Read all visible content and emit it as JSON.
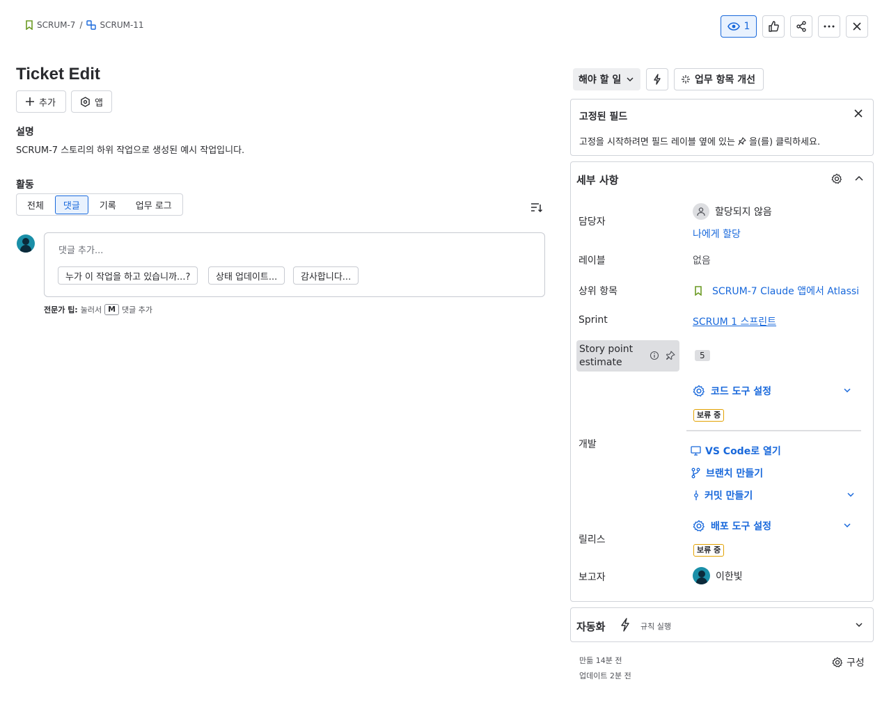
{
  "breadcrumb": {
    "parent": "SCRUM-7",
    "separator": "/",
    "current": "SCRUM-11"
  },
  "toolbar": {
    "watch_count": "1"
  },
  "issue": {
    "title": "Ticket Edit"
  },
  "actions": {
    "add_label": "추가",
    "apps_label": "앱"
  },
  "description": {
    "heading": "설명",
    "text": "SCRUM-7 스토리의 하위 작업으로 생성된 예시 작업입니다."
  },
  "activity": {
    "heading": "활동",
    "tabs": [
      "전체",
      "댓글",
      "기록",
      "업무 로그"
    ],
    "active_tab": "댓글",
    "comment_placeholder": "댓글 추가...",
    "quick_replies": [
      "누가 이 작업을 하고 있습니까...?",
      "상태 업데이트...",
      "감사합니다..."
    ],
    "tip_prefix": "전문가 팁:",
    "tip_press": "눌러서",
    "tip_key": "M",
    "tip_suffix": "댓글 추가"
  },
  "status": {
    "label": "해야 할 일",
    "improve_label": "업무 항목 개선"
  },
  "pinned": {
    "title": "고정된 필드",
    "text_before": "고정을 시작하려면 필드 레이블 옆에 있는",
    "text_after": "을(를) 클릭하세요."
  },
  "details": {
    "title": "세부 사항",
    "assignee_label": "담당자",
    "assignee_value": "할당되지 않음",
    "assign_to_me": "나에게 할당",
    "labels_label": "레이블",
    "labels_value": "없음",
    "parent_label": "상위 항목",
    "parent_value": "SCRUM-7 Claude 앱에서 Atlassi",
    "sprint_label": "Sprint",
    "sprint_value": "SCRUM 1 스프린트",
    "story_points_label_1": "Story point",
    "story_points_label_2": "estimate",
    "story_points_value": "5",
    "dev_label": "개발",
    "code_tool_setup": "코드 도구 설정",
    "pending_badge": "보류 중",
    "open_vscode": "VS Code로 열기",
    "create_branch": "브랜치 만들기",
    "create_commit": "커밋 만들기",
    "release_label": "릴리스",
    "deploy_tool_setup": "배포 도구 설정",
    "release_badge": "보류 중",
    "reporter_label": "보고자",
    "reporter_value": "이한빛"
  },
  "automation": {
    "title": "자동화",
    "rule_run": "규칙 실행"
  },
  "footer": {
    "created": "만듦 14분 전",
    "updated": "업데이트 2분 전",
    "configure": "구성"
  },
  "colors": {
    "accent": "#1868DB",
    "pending": "#E2A100",
    "story_green": "#6A9A23"
  }
}
